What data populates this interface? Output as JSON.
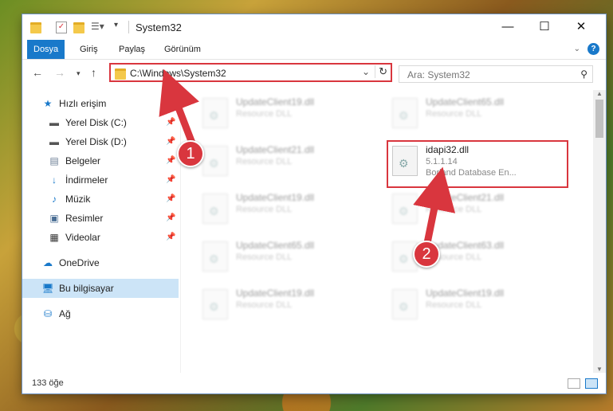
{
  "window": {
    "title": "System32"
  },
  "ribbon": {
    "tabs": [
      "Dosya",
      "Giriş",
      "Paylaş",
      "Görünüm"
    ],
    "help": "?"
  },
  "address": {
    "path": "C:\\Windows\\System32"
  },
  "search": {
    "placeholder": "Ara: System32"
  },
  "sidebar": {
    "items": [
      {
        "label": "Hızlı erişim",
        "icon": "star-icon"
      },
      {
        "label": "Yerel Disk (C:)",
        "icon": "drive-icon",
        "pinned": true
      },
      {
        "label": "Yerel Disk (D:)",
        "icon": "drive-icon",
        "pinned": true
      },
      {
        "label": "Belgeler",
        "icon": "documents-icon",
        "pinned": true
      },
      {
        "label": "İndirmeler",
        "icon": "download-icon",
        "pinned": true
      },
      {
        "label": "Müzik",
        "icon": "music-icon",
        "pinned": true
      },
      {
        "label": "Resimler",
        "icon": "pictures-icon",
        "pinned": true
      },
      {
        "label": "Videolar",
        "icon": "videos-icon",
        "pinned": true
      },
      {
        "label": "OneDrive",
        "icon": "cloud-icon"
      },
      {
        "label": "Bu bilgisayar",
        "icon": "computer-icon",
        "selected": true
      },
      {
        "label": "Ağ",
        "icon": "network-icon"
      }
    ]
  },
  "files": {
    "left_column": [
      {
        "name": "UpdateClient19.dll",
        "sub": "Resource DLL"
      },
      {
        "name": "UpdateClient21.dll",
        "sub": "Resource DLL"
      },
      {
        "name": "UpdateClient19.dll",
        "sub": "Resource DLL"
      },
      {
        "name": "UpdateClient65.dll",
        "sub": "Resource DLL"
      },
      {
        "name": "UpdateClient19.dll",
        "sub": "Resource DLL"
      }
    ],
    "right_column": [
      {
        "name": "UpdateClient65.dll",
        "sub": "Resource DLL"
      },
      {
        "name": "UpdateClient21.dll",
        "sub": "Resource DLL"
      },
      {
        "name": "UpdateClient63.dll",
        "sub": "Resource DLL"
      },
      {
        "name": "UpdateClient19.dll",
        "sub": "Resource DLL"
      }
    ],
    "highlighted": {
      "name": "idapi32.dll",
      "version": "5.1.1.14",
      "description": "Borland Database En..."
    }
  },
  "status": {
    "count": "133 öğe"
  },
  "annotations": {
    "step1": "1",
    "step2": "2",
    "color": "#d9363e"
  },
  "colors": {
    "accent": "#1979ca",
    "selected": "#cce4f7"
  }
}
